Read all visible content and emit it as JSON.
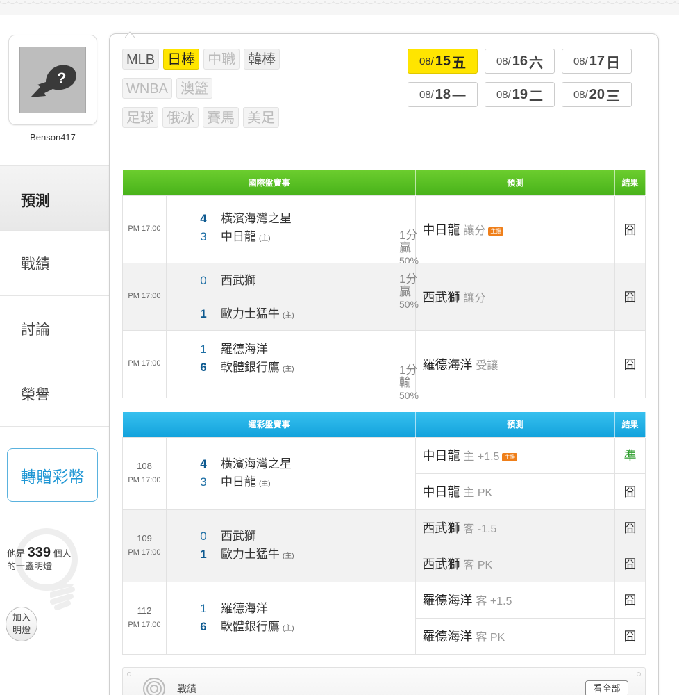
{
  "user": {
    "name": "Benson417"
  },
  "side_nav": [
    {
      "label": "預測",
      "active": true
    },
    {
      "label": "戰績"
    },
    {
      "label": "討論"
    },
    {
      "label": "榮譽"
    }
  ],
  "gift_button": "轉贈彩幣",
  "bulb": {
    "prefix": "他是",
    "count": "339",
    "suffix": "個人",
    "line2": "的一盞明燈",
    "join_line1": "加入",
    "join_line2": "明燈"
  },
  "sport_tags": {
    "row1": [
      {
        "label": "MLB"
      },
      {
        "label": "日棒",
        "active": true
      },
      {
        "label": "中職",
        "disabled": true
      },
      {
        "label": "韓棒"
      }
    ],
    "row2": [
      {
        "label": "WNBA",
        "disabled": true
      },
      {
        "label": "澳籃",
        "disabled": true
      }
    ],
    "row3": [
      {
        "label": "足球",
        "disabled": true
      },
      {
        "label": "俄冰",
        "disabled": true
      },
      {
        "label": "賽馬",
        "disabled": true
      },
      {
        "label": "美足",
        "disabled": true
      }
    ]
  },
  "dates": [
    {
      "md": "08/",
      "day": "15",
      "wd": "五",
      "active": true
    },
    {
      "md": "08/",
      "day": "16",
      "wd": "六"
    },
    {
      "md": "08/",
      "day": "17",
      "wd": "日"
    },
    {
      "md": "08/",
      "day": "18",
      "wd": "一"
    },
    {
      "md": "08/",
      "day": "19",
      "wd": "二"
    },
    {
      "md": "08/",
      "day": "20",
      "wd": "三"
    }
  ],
  "intl_table": {
    "header": {
      "games": "國際盤賽事",
      "pred": "預測",
      "result": "結果"
    },
    "home_mark": "(主)",
    "rows": [
      {
        "time": "PM 17:00",
        "s1": "4",
        "t1": "橫濱海灣之星",
        "s2": "3",
        "t2": "中日龍",
        "hc1": "1分贏",
        "hc2": "50%",
        "pred_team": "中日龍",
        "pred_sub": "讓分",
        "badge": "主推",
        "result": "囧"
      },
      {
        "time": "PM 17:00",
        "s1": "0",
        "t1": "西武獅",
        "s2": "1",
        "t2": "歐力士猛牛",
        "hc1": "1分贏",
        "hc2": "50%",
        "pred_team": "西武獅",
        "pred_sub": "讓分",
        "result": "囧"
      },
      {
        "time": "PM 17:00",
        "s1": "1",
        "t1": "羅德海洋",
        "s2": "6",
        "t2": "軟體銀行鷹",
        "hc1": "1分輸",
        "hc2": "50%",
        "pred_team": "羅德海洋",
        "pred_sub": "受讓",
        "result": "囧"
      }
    ]
  },
  "lottery_table": {
    "header": {
      "games": "運彩盤賽事",
      "pred": "預測",
      "result": "結果"
    },
    "rows": [
      {
        "no": "108",
        "time": "PM 17:00",
        "s1": "4",
        "t1": "橫濱海灣之星",
        "s2": "3",
        "t2": "中日龍",
        "preds": [
          {
            "team": "中日龍",
            "sub": "主 +1.5",
            "badge": "主推",
            "result": "準"
          },
          {
            "team": "中日龍",
            "sub": "主 PK",
            "result": "囧"
          }
        ]
      },
      {
        "no": "109",
        "time": "PM 17:00",
        "s1": "0",
        "t1": "西武獅",
        "s2": "1",
        "t2": "歐力士猛牛",
        "preds": [
          {
            "team": "西武獅",
            "sub": "客 -1.5",
            "result": "囧"
          },
          {
            "team": "西武獅",
            "sub": "客 PK",
            "result": "囧"
          }
        ]
      },
      {
        "no": "112",
        "time": "PM 17:00",
        "s1": "1",
        "t1": "羅德海洋",
        "s2": "6",
        "t2": "軟體銀行鷹",
        "preds": [
          {
            "team": "羅德海洋",
            "sub": "客 +1.5",
            "result": "囧"
          },
          {
            "team": "羅德海洋",
            "sub": "客 PK",
            "result": "囧"
          }
        ]
      }
    ]
  },
  "record_bar": {
    "label": "戰績",
    "see_all": "看全部"
  },
  "colors": {
    "accent_yellow": "#ffe500",
    "green_header": "#48b21a",
    "blue_header": "#12a2dc",
    "badge_orange": "#ef7f1a",
    "hit_green": "#2f9e2f"
  }
}
